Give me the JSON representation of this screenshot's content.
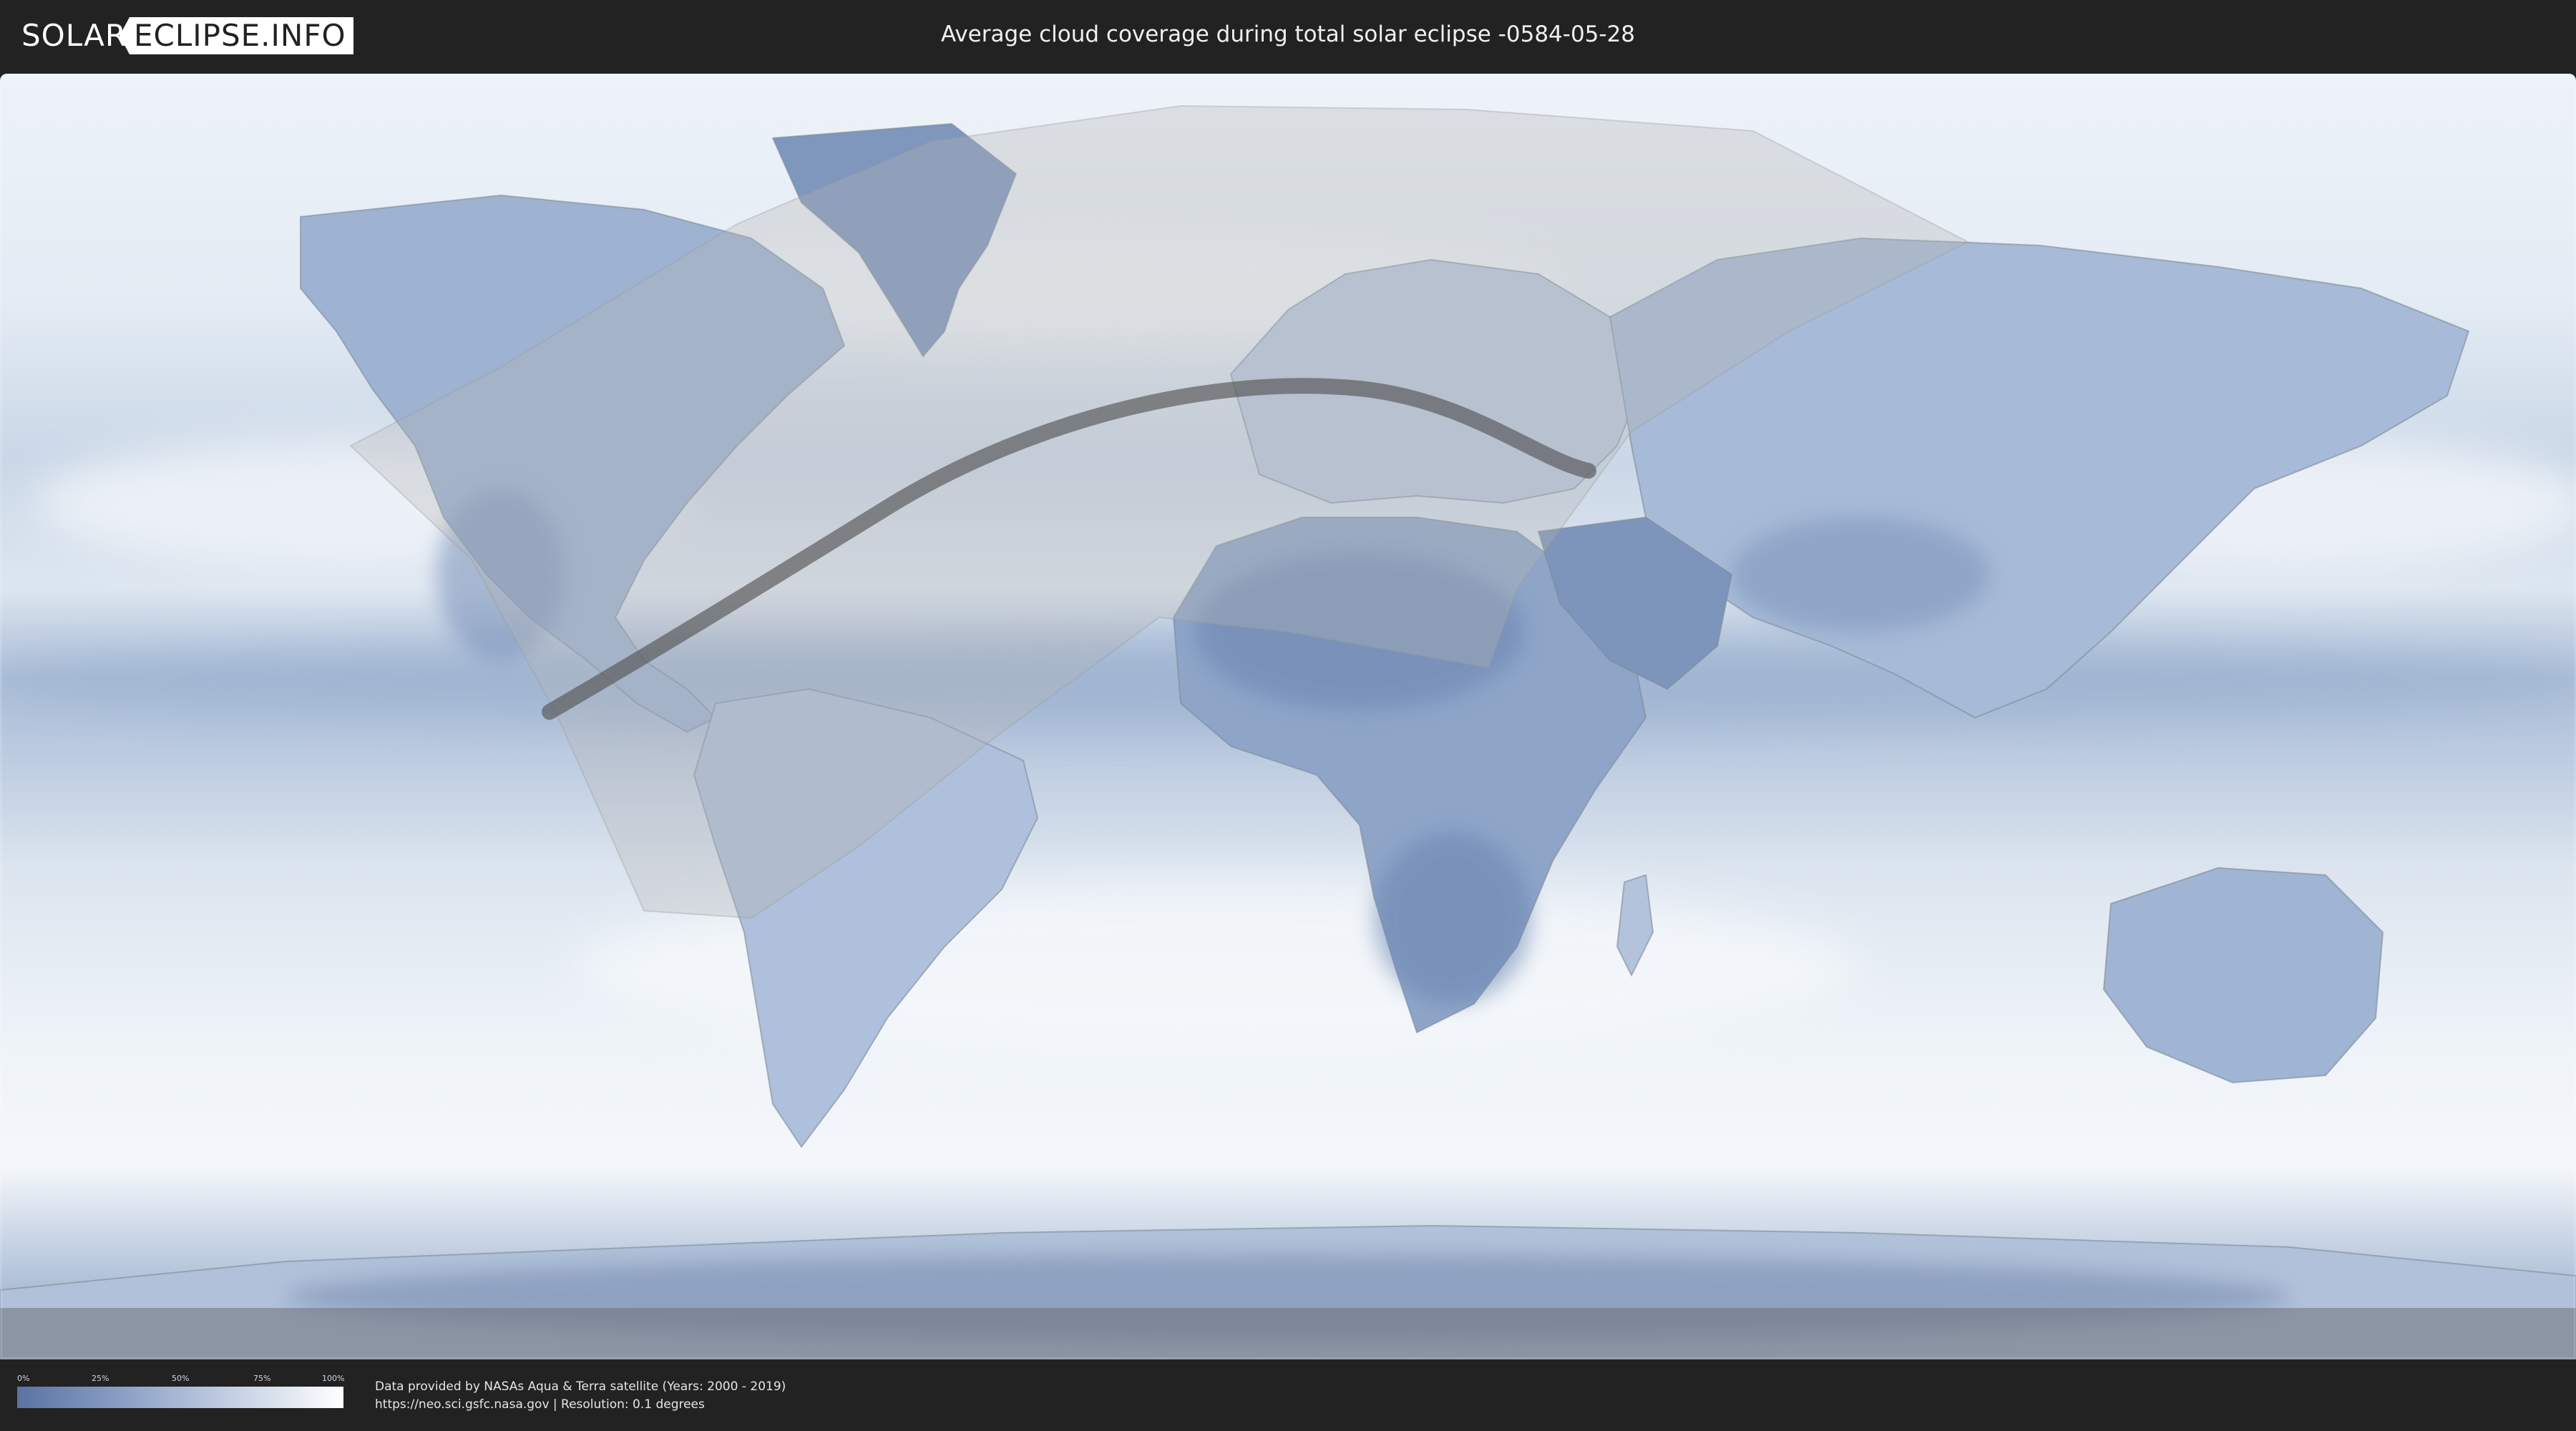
{
  "header": {
    "logo_part1": "SOLAR",
    "logo_part2": "ECLIPSE.INFO",
    "title": "Average cloud coverage during total solar eclipse -0584-05-28"
  },
  "legend": {
    "ticks": [
      "0%",
      "25%",
      "50%",
      "75%",
      "100%"
    ],
    "color_low": "#5a73a3",
    "color_high": "#ffffff"
  },
  "footer": {
    "source_line1": "Data provided by NASAs Aqua & Terra satellite (Years: 2000 - 2019)",
    "source_line2": "https://neo.sci.gsfc.nasa.gov | Resolution: 0.1 degrees"
  },
  "colors": {
    "background": "#222222",
    "clear_sky": "#5a73a3",
    "cloudy": "#ffffff",
    "penumbra_overlay": "#b4b4b4",
    "totality_path": "#555555"
  }
}
